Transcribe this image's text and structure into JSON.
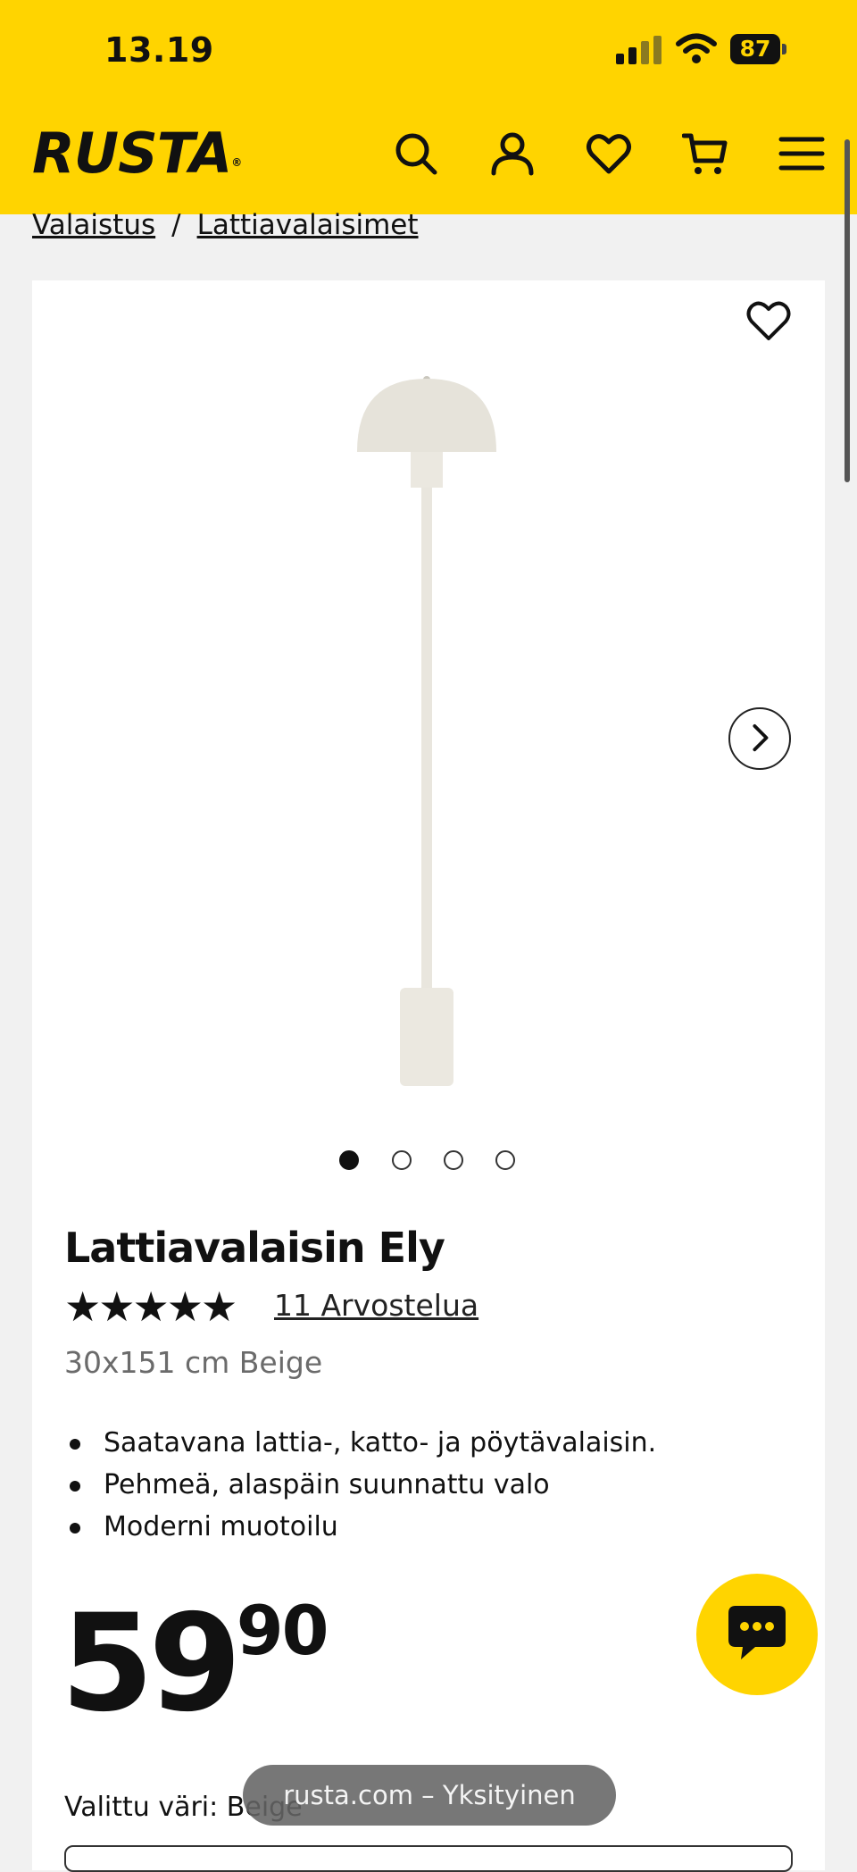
{
  "status_bar": {
    "time": "13.19",
    "battery": "87"
  },
  "header": {
    "logo": "RUSTA",
    "logo_mark": "®"
  },
  "breadcrumb": {
    "items": [
      "Valaistus",
      "Lattiavalaisimet"
    ],
    "separator": "/"
  },
  "gallery": {
    "image_count": 4,
    "active_index": 0
  },
  "product": {
    "title": "Lattiavalaisin Ely",
    "rating": 5,
    "stars": "★★★★★",
    "reviews": "11 Arvostelua",
    "variant": "30x151 cm Beige",
    "features": [
      "Saatavana lattia-, katto- ja pöytävalaisin.",
      "Pehmeä, alaspäin suunnattu valo",
      "Moderni muotoilu"
    ],
    "price_integer": "59",
    "price_decimal": "90",
    "color_label": "Valittu väri:",
    "color_value": "Beige"
  },
  "browser": {
    "url_label": "rusta.com – Yksityinen"
  },
  "colors": {
    "brand_yellow": "#ffd400",
    "text": "#111111",
    "muted": "#6b6b6b"
  },
  "icons": [
    "search-icon",
    "account-icon",
    "heart-icon",
    "cart-icon",
    "menu-icon",
    "chevron-right-icon",
    "chat-icon"
  ]
}
